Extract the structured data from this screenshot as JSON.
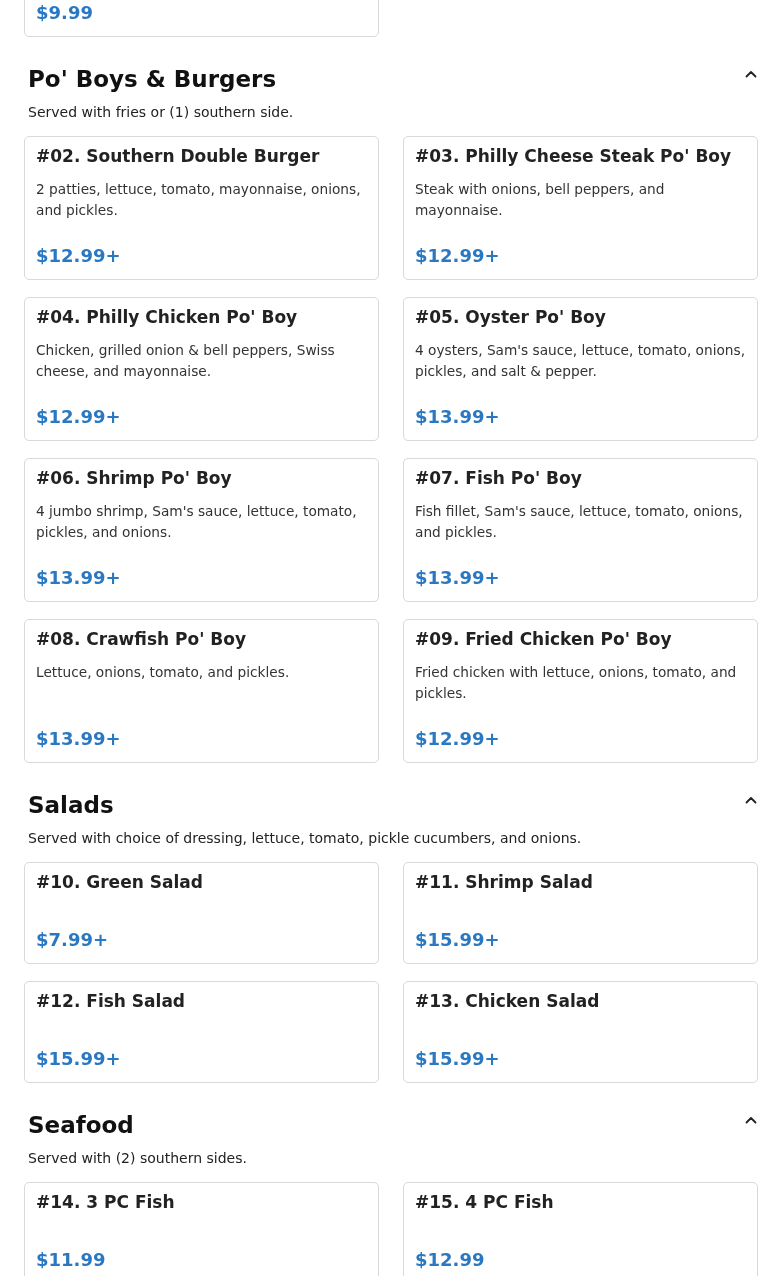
{
  "top_card": {
    "price": "$9.99"
  },
  "sections": [
    {
      "title": "Po' Boys & Burgers",
      "subtitle": "Served with fries or (1) southern side.",
      "expanded": true,
      "items": [
        {
          "name": "#02. Southern Double Burger",
          "description": "2 patties, lettuce, tomato, mayonnaise, onions, and pickles.",
          "price": "$12.99+"
        },
        {
          "name": "#03. Philly Cheese Steak Po' Boy",
          "description": "Steak with onions, bell peppers, and mayonnaise.",
          "price": "$12.99+"
        },
        {
          "name": "#04. Philly Chicken Po' Boy",
          "description": "Chicken, grilled onion & bell peppers, Swiss cheese, and mayonnaise.",
          "price": "$12.99+"
        },
        {
          "name": "#05. Oyster Po' Boy",
          "description": "4 oysters, Sam's sauce, lettuce, tomato, onions, pickles, and salt & pepper.",
          "price": "$13.99+"
        },
        {
          "name": "#06. Shrimp Po' Boy",
          "description": "4 jumbo shrimp, Sam's sauce, lettuce, tomato, pickles, and onions.",
          "price": "$13.99+"
        },
        {
          "name": "#07. Fish Po' Boy",
          "description": "Fish fillet, Sam's sauce, lettuce, tomato, onions, and pickles.",
          "price": "$13.99+"
        },
        {
          "name": "#08. Crawfish Po' Boy",
          "description": "Lettuce, onions, tomato, and pickles.",
          "price": "$13.99+"
        },
        {
          "name": "#09. Fried Chicken Po' Boy",
          "description": "Fried chicken with lettuce, onions, tomato, and pickles.",
          "price": "$12.99+"
        }
      ]
    },
    {
      "title": "Salads",
      "subtitle": "Served with choice of dressing, lettuce, tomato, pickle cucumbers, and onions.",
      "expanded": true,
      "items": [
        {
          "name": "#10. Green Salad",
          "price": "$7.99+"
        },
        {
          "name": "#11. Shrimp Salad",
          "price": "$15.99+"
        },
        {
          "name": "#12. Fish Salad",
          "price": "$15.99+"
        },
        {
          "name": "#13. Chicken Salad",
          "price": "$15.99+"
        }
      ]
    },
    {
      "title": "Seafood",
      "subtitle": "Served with (2) southern sides.",
      "expanded": true,
      "items": [
        {
          "name": "#14. 3 PC Fish",
          "price": "$11.99"
        },
        {
          "name": "#15. 4 PC Fish",
          "price": "$12.99"
        }
      ]
    }
  ]
}
